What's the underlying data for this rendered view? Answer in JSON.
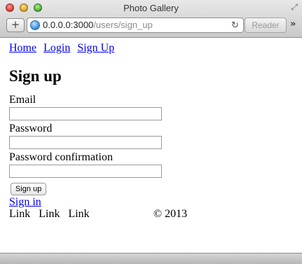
{
  "window": {
    "title": "Photo Gallery"
  },
  "toolbar": {
    "add_label": "+",
    "url_host": "0.0.0.0:3000",
    "url_path": "/users/sign_up",
    "reader_label": "Reader",
    "reload_glyph": "↻",
    "more_glyph": "»",
    "resize_glyph": "⤢"
  },
  "nav": {
    "home": "Home",
    "login": "Login",
    "signup": "Sign Up"
  },
  "page": {
    "heading": "Sign up"
  },
  "form": {
    "email_label": "Email",
    "email_value": "",
    "password_label": "Password",
    "password_value": "",
    "password_confirmation_label": "Password confirmation",
    "password_confirmation_value": "",
    "submit_label": "Sign up"
  },
  "links": {
    "sign_in": "Sign in"
  },
  "footer": {
    "links": [
      "Link",
      "Link",
      "Link"
    ],
    "copyright": "© 2013"
  }
}
